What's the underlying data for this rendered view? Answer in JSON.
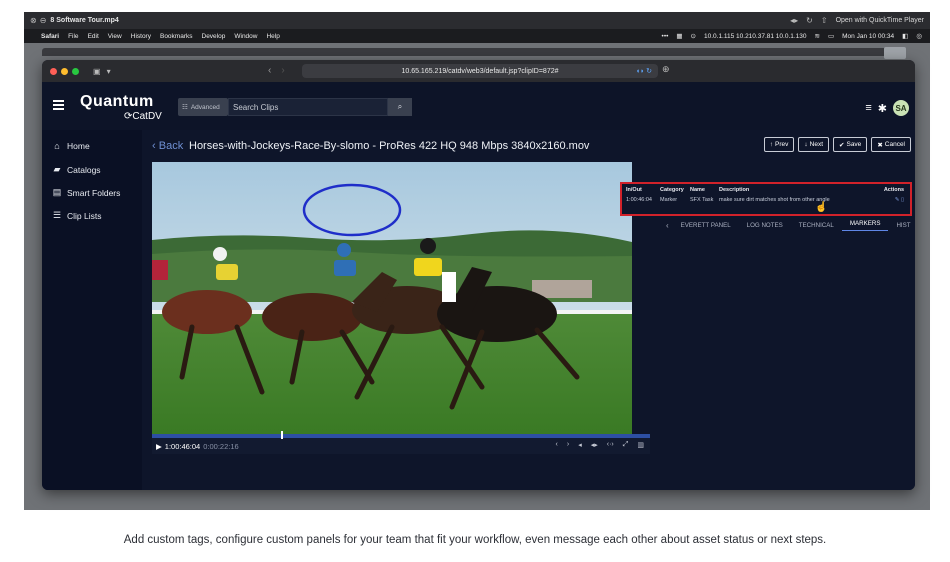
{
  "qt_bar": {
    "title": "8 Software Tour.mp4",
    "open_with": "Open with QuickTime Player"
  },
  "mac_menu": {
    "app": "Safari",
    "items": [
      "File",
      "Edit",
      "View",
      "History",
      "Bookmarks",
      "Develop",
      "Window",
      "Help"
    ],
    "ips": "10.0.1.115  10.210.37.81  10.0.1.130",
    "clock": "Mon Jan 10  00:34"
  },
  "browser": {
    "url": "10.65.165.219/catdv/web3/default.jsp?clipID=872#"
  },
  "header": {
    "logo": "Quantum",
    "logo_sub": "CatDV",
    "advanced_label": "Advanced",
    "search_placeholder": "Search Clips",
    "avatar": "SA"
  },
  "sidebar": {
    "items": [
      {
        "label": "Home",
        "icon": "home-icon"
      },
      {
        "label": "Catalogs",
        "icon": "briefcase-icon"
      },
      {
        "label": "Smart Folders",
        "icon": "folder-icon"
      },
      {
        "label": "Clip Lists",
        "icon": "list-icon"
      }
    ]
  },
  "clip": {
    "back_label": "Back",
    "title": "Horses-with-Jockeys-Race-By-slomo - ProRes 422 HQ 948 Mbps 3840x2160.mov",
    "prev_label": "Prev",
    "next_label": "Next",
    "save_label": "Save",
    "cancel_label": "Cancel"
  },
  "player": {
    "timecode": "1:00:46:04",
    "duration": "0:00:22:16",
    "progress": 0.26
  },
  "tabs": [
    "EVERETT PANEL",
    "LOG NOTES",
    "TECHNICAL",
    "MARKERS",
    "HIST"
  ],
  "active_tab": "MARKERS",
  "markers": {
    "headers": [
      "In/Out",
      "Category",
      "Name",
      "Description",
      "Actions"
    ],
    "rows": [
      {
        "inout": "1:00:46:04",
        "category": "Marker",
        "name": "SFX Task",
        "description": "make sure dirt matches shot from other angle"
      }
    ]
  },
  "caption": "Add custom tags, configure custom panels for your team that fit your workflow, even message each other about asset status or next steps.",
  "colors": {
    "app_bg": "#0e152a",
    "accent_blue": "#2d4fa3",
    "highlight_red": "#d1222a",
    "annotation_blue": "#1f2ec9"
  }
}
